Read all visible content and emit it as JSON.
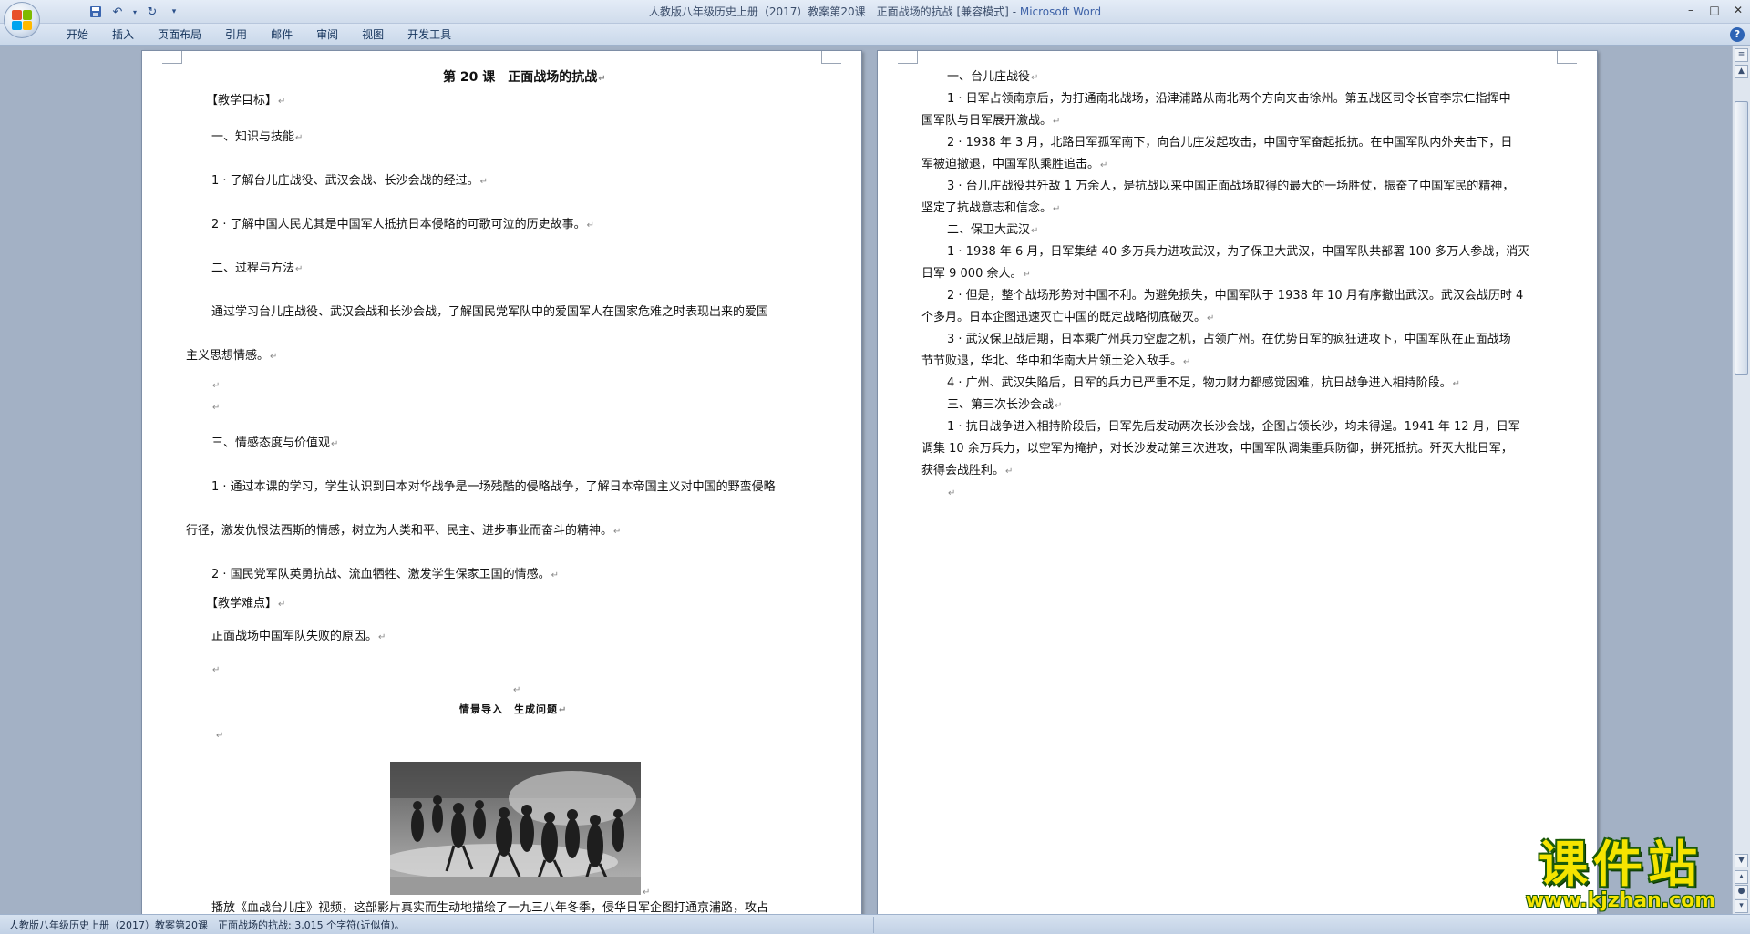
{
  "window": {
    "title": "人教版八年级历史上册（2017）教案第20课　正面战场的抗战 [兼容模式]",
    "title_sep": " - ",
    "app": "Microsoft Word"
  },
  "qat": {
    "save_icon": "save-icon",
    "undo_icon": "undo-icon",
    "redo_icon": "redo-icon",
    "customize_icon": "customize-icon"
  },
  "ribbon": {
    "tabs": [
      "开始",
      "插入",
      "页面布局",
      "引用",
      "邮件",
      "审阅",
      "视图",
      "开发工具"
    ],
    "help": "?"
  },
  "left_page": {
    "title": "第 20 课　正面战场的抗战",
    "lines": [
      "【教学目标】",
      "一、知识与技能",
      "1 · 了解台儿庄战役、武汉会战、长沙会战的经过。",
      "2 · 了解中国人民尤其是中国军人抵抗日本侵略的可歌可泣的历史故事。",
      "二、过程与方法",
      "通过学习台儿庄战役、武汉会战和长沙会战，了解国民党军队中的爱国军人在国家危难之时表现出来的爱国",
      "主义思想情感。",
      "三、情感态度与价值观",
      "1 · 通过本课的学习，学生认识到日本对华战争是一场残酷的侵略战争，了解日本帝国主义对中国的野蛮侵略",
      "行径，激发仇恨法西斯的情感，树立为人类和平、民主、进步事业而奋斗的精神。",
      "2 · 国民党军队英勇抗战、流血牺牲、激发学生保家卫国的情感。",
      "【教学难点】",
      "正面战场中国军队失败的原因。",
      "情景导入　生成问题",
      "播放《血战台儿庄》视频，这部影片真实而生动地描绘了一九三八年冬季，侵华日军企图打通京浦路，攻占"
    ]
  },
  "right_page": {
    "lines": [
      "一、台儿庄战役",
      "1 · 日军占领南京后，为打通南北战场，沿津浦路从南北两个方向夹击徐州。第五战区司令长官李宗仁指挥中",
      "国军队与日军展开激战。",
      "2 · 1938 年 3 月，北路日军孤军南下，向台儿庄发起攻击，中国守军奋起抵抗。在中国军队内外夹击下，日",
      "军被迫撤退，中国军队乘胜追击。",
      "3 · 台儿庄战役共歼敌 1 万余人，是抗战以来中国正面战场取得的最大的一场胜仗，振奋了中国军民的精神，",
      "坚定了抗战意志和信念。",
      "二、保卫大武汉",
      "1 · 1938 年 6 月，日军集结 40 多万兵力进攻武汉，为了保卫大武汉，中国军队共部署 100 多万人参战，消灭",
      "日军 9 000 余人。",
      "2 · 但是，整个战场形势对中国不利。为避免损失，中国军队于 1938 年 10 月有序撤出武汉。武汉会战历时 4",
      "个多月。日本企图迅速灭亡中国的既定战略彻底破灭。",
      "3 · 武汉保卫战后期，日本乘广州兵力空虚之机，占领广州。在优势日军的疯狂进攻下，中国军队在正面战场",
      "节节败退，华北、华中和华南大片领土沦入敌手。",
      "4 · 广州、武汉失陷后，日军的兵力已严重不足，物力财力都感觉困难，抗日战争进入相持阶段。",
      "三、第三次长沙会战",
      "1 · 抗日战争进入相持阶段后，日军先后发动两次长沙会战，企图占领长沙，均未得逞。1941 年 12 月，日军",
      "调集 10 余万兵力，以空军为掩护，对长沙发动第三次进攻，中国军队调集重兵防御，拼死抵抗。歼灭大批日军，",
      "获得会战胜利。"
    ]
  },
  "paragraph_mark": "↵",
  "status": {
    "text": "人教版八年级历史上册（2017）教案第20课　正面战场的抗战: 3,015 个字符(近似值)。"
  },
  "watermark": {
    "title": "课件站",
    "url": "www.kjzhan.com"
  },
  "colors": {
    "page": "#ffffff",
    "workspace": "#a3b1c5",
    "ribbon": "#d6e2f1",
    "watermark_fill": "#f5e400",
    "watermark_outline": "#1b5a0a"
  }
}
